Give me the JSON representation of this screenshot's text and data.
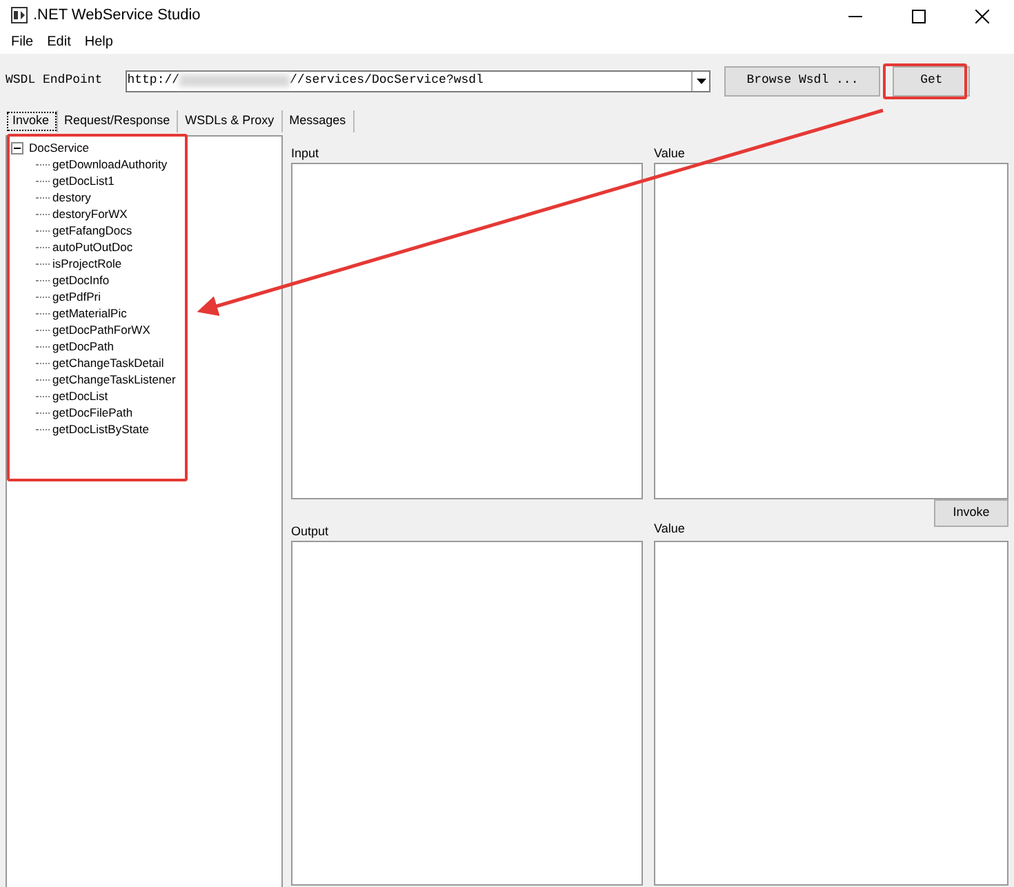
{
  "window": {
    "title": ".NET WebService Studio"
  },
  "menu": [
    "File",
    "Edit",
    "Help"
  ],
  "endpoint": {
    "label": "WSDL EndPoint",
    "value_start": "http://",
    "value_end": "//services/DocService?wsdl",
    "browse_button": "Browse Wsdl ...",
    "get_button": "Get"
  },
  "tabs": [
    {
      "label": "Invoke",
      "selected": true
    },
    {
      "label": "Request/Response",
      "selected": false
    },
    {
      "label": "WSDLs & Proxy",
      "selected": false
    },
    {
      "label": "Messages",
      "selected": false
    }
  ],
  "tree": {
    "label": "DocService",
    "expanded": true,
    "children": [
      {
        "label": "getDownloadAuthority"
      },
      {
        "label": "getDocList1"
      },
      {
        "label": "destory"
      },
      {
        "label": "destoryForWX"
      },
      {
        "label": "getFafangDocs"
      },
      {
        "label": "autoPutOutDoc"
      },
      {
        "label": "isProjectRole"
      },
      {
        "label": "getDocInfo"
      },
      {
        "label": "getPdfPri"
      },
      {
        "label": "getMaterialPic"
      },
      {
        "label": "getDocPathForWX"
      },
      {
        "label": "getDocPath"
      },
      {
        "label": "getChangeTaskDetail"
      },
      {
        "label": "getChangeTaskListener"
      },
      {
        "label": "getDocList"
      },
      {
        "label": "getDocFilePath"
      },
      {
        "label": "getDocListByState"
      }
    ]
  },
  "panels": {
    "input_label": "Input",
    "input_value_label": "Value",
    "invoke_button": "Invoke",
    "output_label": "Output",
    "output_value_label": "Value"
  }
}
